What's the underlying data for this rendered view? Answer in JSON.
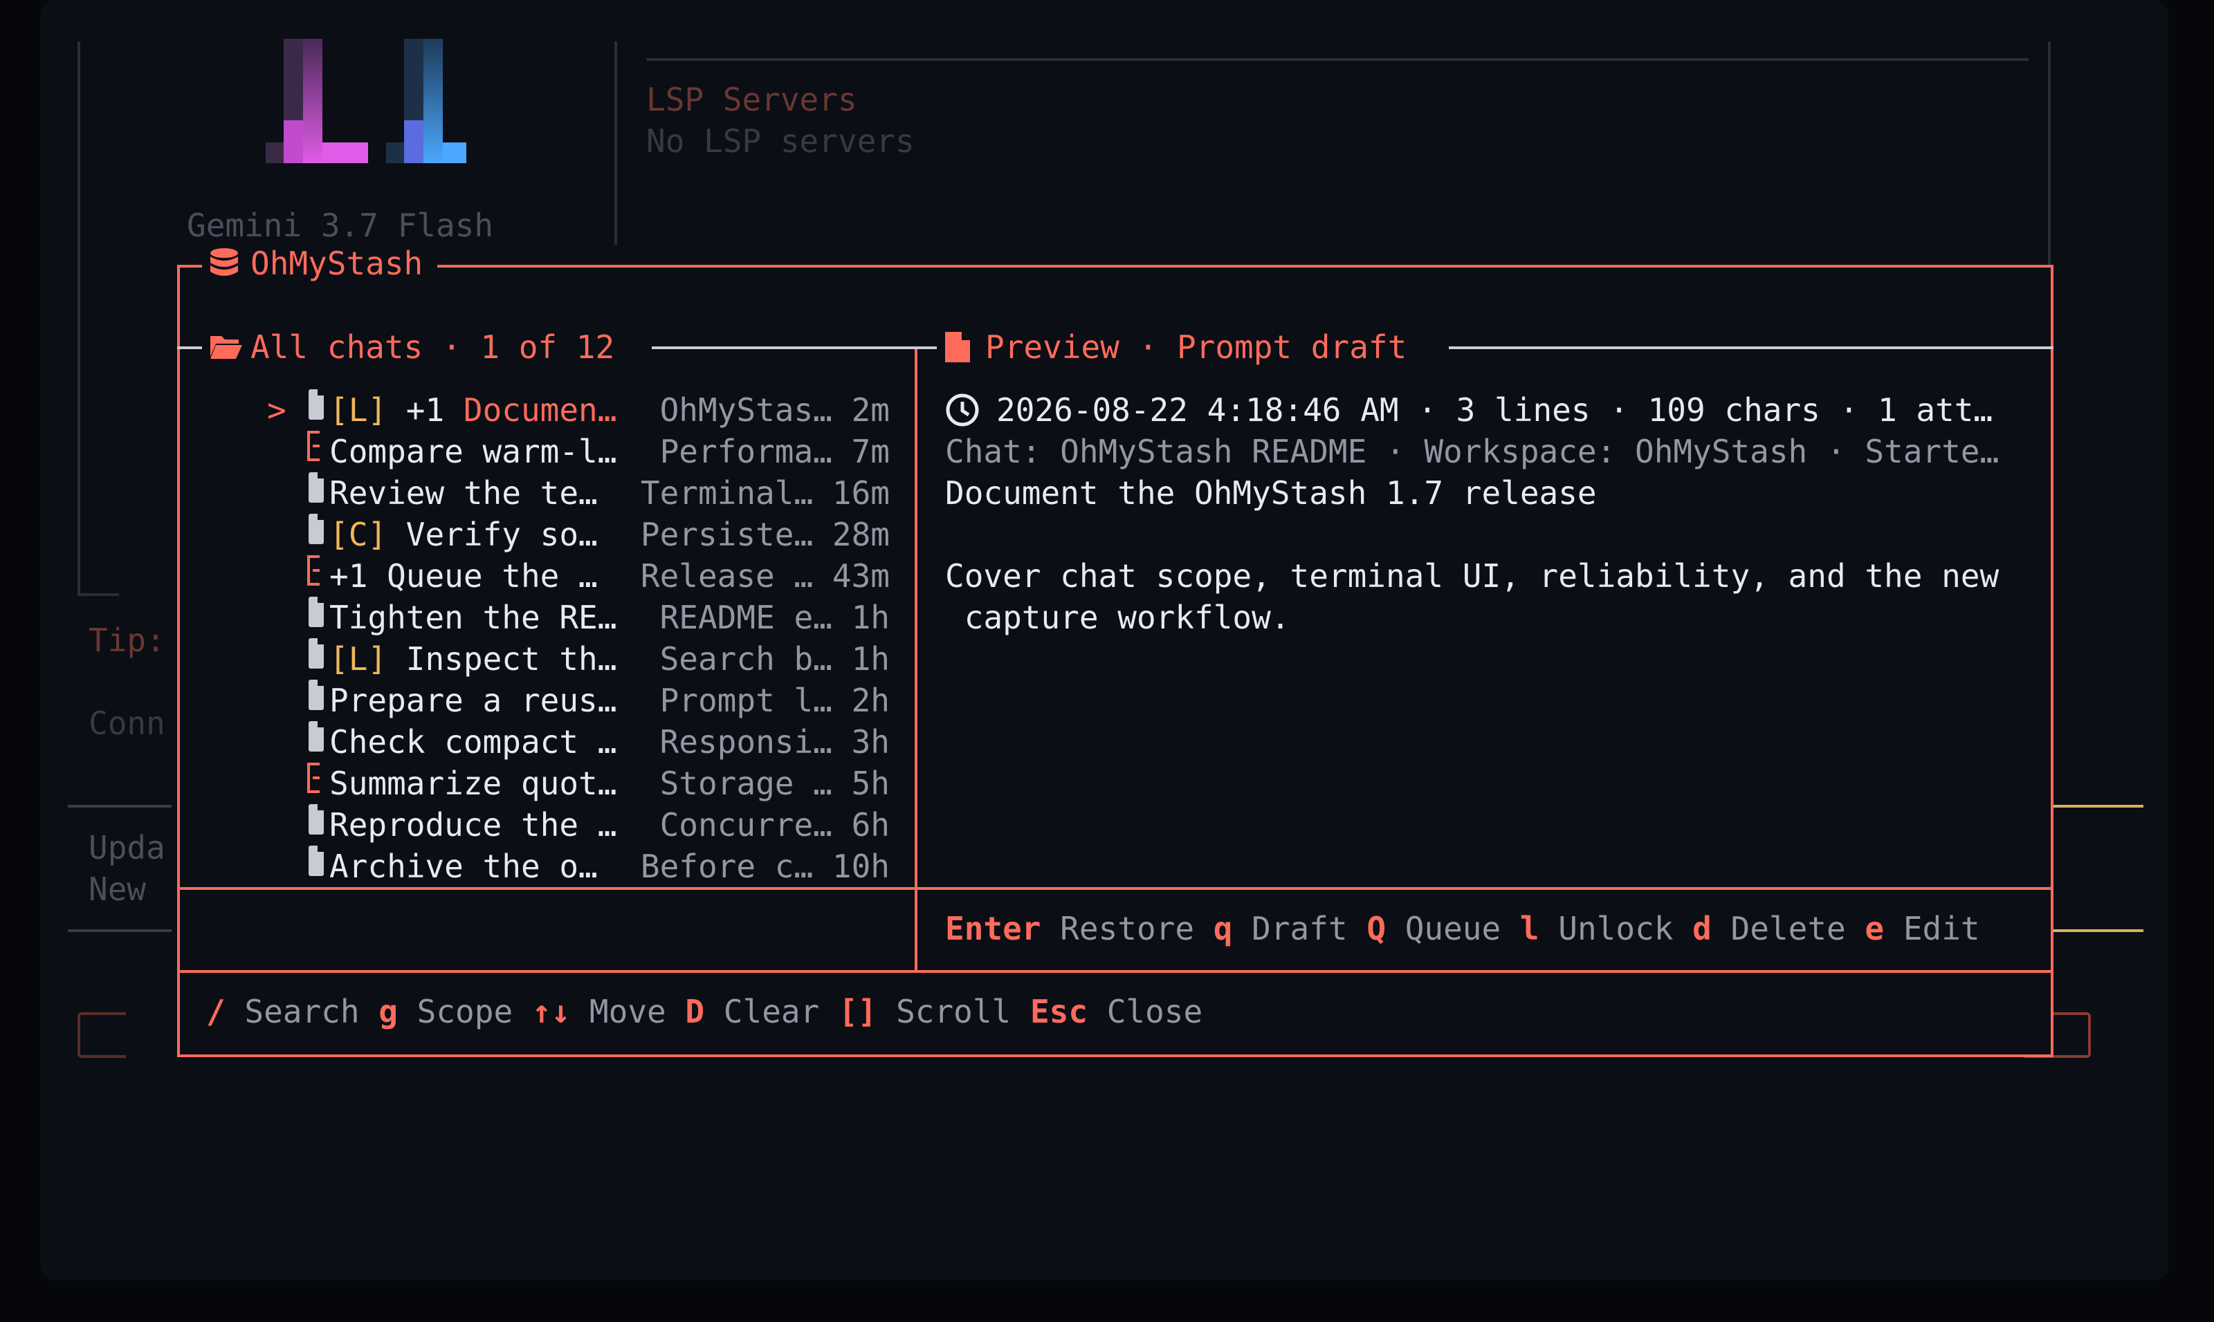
{
  "background": {
    "model": "Gemini 3.7 Flash",
    "lsp_title": "LSP Servers",
    "lsp_status": "No LSP servers",
    "tip": "Tip:",
    "conn": "Conn",
    "upda": "Upda",
    "new": "New"
  },
  "modal": {
    "title": "OhMyStash",
    "list_header": "All chats · 1 of 12",
    "selector": ">",
    "chats": [
      {
        "tag": "[L]",
        "tag_color": "yellow",
        "prefix": "+1 ",
        "title": "Documen…",
        "source": "OhMyStas…",
        "time": "2m",
        "icon": "file",
        "selected": true
      },
      {
        "tag": "",
        "prefix": "",
        "title": "Compare warm-l…",
        "source": "Performa…",
        "time": "7m",
        "icon": "bracket"
      },
      {
        "tag": "",
        "prefix": "",
        "title": "Review the te…",
        "source": "Terminal…",
        "time": "16m",
        "icon": "file"
      },
      {
        "tag": "[C]",
        "tag_color": "yellow",
        "prefix": "",
        "title": "Verify so…",
        "source": "Persiste…",
        "time": "28m",
        "icon": "file"
      },
      {
        "tag": "",
        "prefix": "+1 ",
        "title": "Queue the …",
        "source": "Release …",
        "time": "43m",
        "icon": "bracket"
      },
      {
        "tag": "",
        "prefix": "",
        "title": "Tighten the RE…",
        "source": "README e…",
        "time": "1h",
        "icon": "file"
      },
      {
        "tag": "[L]",
        "tag_color": "yellow",
        "prefix": "",
        "title": "Inspect th…",
        "source": "Search b…",
        "time": "1h",
        "icon": "file"
      },
      {
        "tag": "",
        "prefix": "",
        "title": "Prepare a reus…",
        "source": "Prompt l…",
        "time": "2h",
        "icon": "file"
      },
      {
        "tag": "",
        "prefix": "",
        "title": "Check compact …",
        "source": "Responsi…",
        "time": "3h",
        "icon": "file"
      },
      {
        "tag": "",
        "prefix": "",
        "title": "Summarize quot…",
        "source": "Storage …",
        "time": "5h",
        "icon": "bracket"
      },
      {
        "tag": "",
        "prefix": "",
        "title": "Reproduce the …",
        "source": "Concurre…",
        "time": "6h",
        "icon": "file"
      },
      {
        "tag": "",
        "prefix": "",
        "title": "Archive the o…",
        "source": "Before c…",
        "time": "10h",
        "icon": "file"
      }
    ],
    "preview_header": "Preview · Prompt draft",
    "preview_meta": "2026-08-22 4:18:46 AM · 3 lines · 109 chars · 1 att…",
    "preview_context": "Chat: OhMyStash README · Workspace: OhMyStash · Starte…",
    "preview_line1": "Document the OhMyStash 1.7 release",
    "preview_line2": "Cover chat scope, terminal UI, reliability, and the new",
    "preview_line3": " capture workflow.",
    "actions": [
      {
        "key": "Enter",
        "label": "Restore"
      },
      {
        "key": "q",
        "label": "Draft"
      },
      {
        "key": "Q",
        "label": "Queue"
      },
      {
        "key": "l",
        "label": "Unlock"
      },
      {
        "key": "d",
        "label": "Delete"
      },
      {
        "key": "e",
        "label": "Edit"
      }
    ],
    "footer": [
      {
        "key": "/",
        "label": "Search"
      },
      {
        "key": "g",
        "label": "Scope"
      },
      {
        "key": "↑↓",
        "label": "Move"
      },
      {
        "key": "D",
        "label": "Clear"
      },
      {
        "key": "[]",
        "label": "Scroll"
      },
      {
        "key": "Esc",
        "label": "Close"
      }
    ]
  },
  "colors": {
    "accent": "#ff6b5b",
    "yellow": "#f0b85a",
    "background": "#0b0e15",
    "logo_pink": "#e05ce8",
    "logo_blue": "#4aa8ff"
  }
}
